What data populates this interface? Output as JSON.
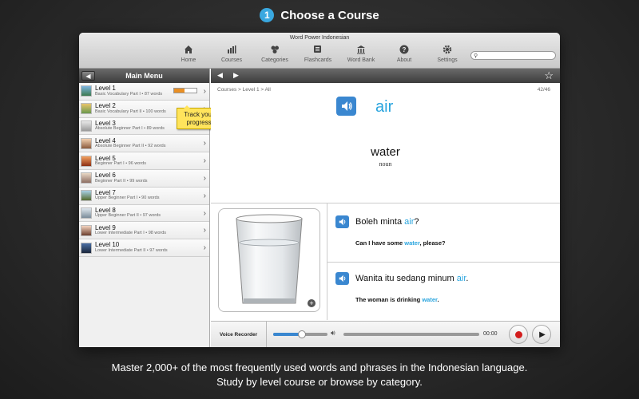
{
  "caption": {
    "step": "1",
    "title": "Choose a Course",
    "bottom_line1": "Master 2,000+ of the most frequently used words and phrases in the Indonesian language.",
    "bottom_line2": "Study by level course or browse by category."
  },
  "window": {
    "title": "Word Power Indonesian"
  },
  "toolbar": [
    {
      "label": "Home",
      "icon": "home-icon"
    },
    {
      "label": "Courses",
      "icon": "courses-icon"
    },
    {
      "label": "Categories",
      "icon": "categories-icon"
    },
    {
      "label": "Flashcards",
      "icon": "flashcards-icon"
    },
    {
      "label": "Word Bank",
      "icon": "word-bank-icon"
    },
    {
      "label": "About",
      "icon": "about-icon"
    },
    {
      "label": "Settings",
      "icon": "settings-icon"
    }
  ],
  "sidebar": {
    "title": "Main Menu",
    "levels": [
      {
        "name": "Level 1",
        "sub": "Basic Vocabulary Part I • 87 words",
        "progress": 0.45
      },
      {
        "name": "Level 2",
        "sub": "Basic Vocabulary Part II • 100 words"
      },
      {
        "name": "Level 3",
        "sub": "Absolute Beginner Part I • 89 words"
      },
      {
        "name": "Level 4",
        "sub": "Absolute Beginner Part II • 92 words"
      },
      {
        "name": "Level 5",
        "sub": "Beginner Part I • 96 words"
      },
      {
        "name": "Level 6",
        "sub": "Beginner Part II • 99 words"
      },
      {
        "name": "Level 7",
        "sub": "Upper Beginner Part I • 90 words"
      },
      {
        "name": "Level 8",
        "sub": "Upper Beginner Part II • 97 words"
      },
      {
        "name": "Level 9",
        "sub": "Lower Intermediate Part I • 98 words"
      },
      {
        "name": "Level 10",
        "sub": "Lower Intermediate Part II • 97 words"
      }
    ],
    "callout": "Track your progress"
  },
  "main": {
    "breadcrumb": "Courses > Level 1 > All",
    "counter": "42/46",
    "word": "air",
    "translation": "water",
    "part_of_speech": "noun",
    "sentence1": {
      "pre": "Boleh minta ",
      "hl": "air",
      "post": "?",
      "en_pre": "Can I have some ",
      "en_hl": "water",
      "en_post": ", please?"
    },
    "sentence2": {
      "pre": "Wanita itu sedang minum ",
      "hl": "air",
      "post": ".",
      "en_pre": "The woman is drinking ",
      "en_hl": "water",
      "en_post": "."
    }
  },
  "recorder": {
    "label": "Voice Recorder",
    "time": "00:00",
    "volume": 0.5
  },
  "colors": {
    "accent": "#2aa5de",
    "speaker": "#3a87d0",
    "record": "#d31e1e",
    "callout": "#ffe45c"
  }
}
